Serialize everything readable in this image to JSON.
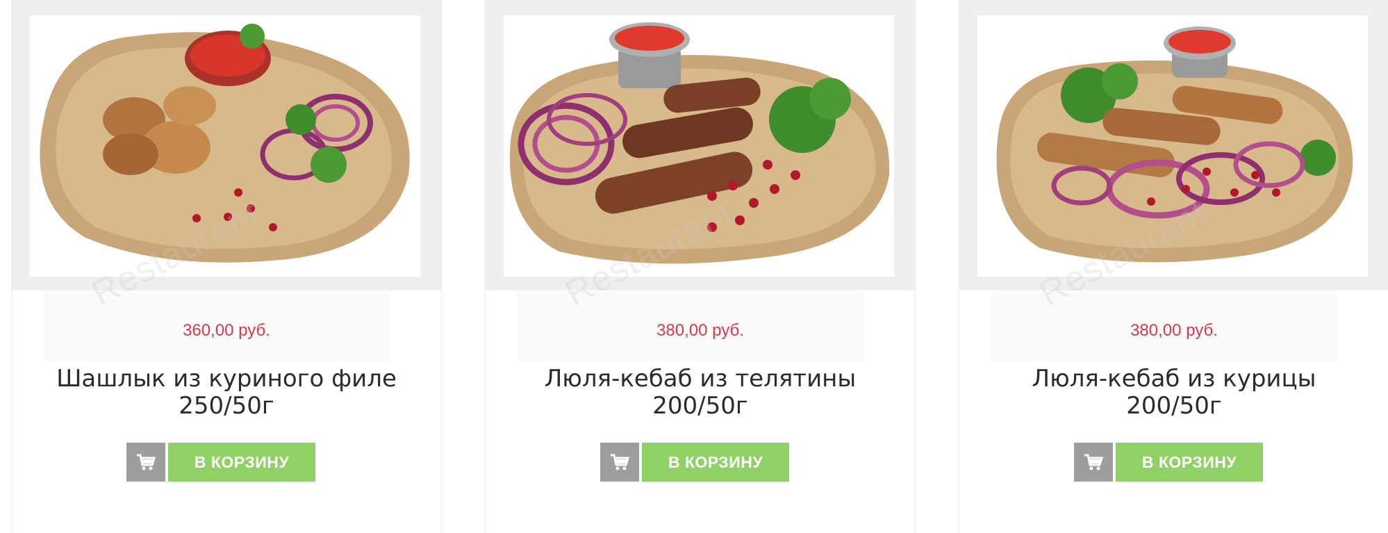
{
  "products": [
    {
      "price": "360,00 руб.",
      "title_line1": "Шашлык из куриного филе",
      "title_line2": "250/50г",
      "watermark": "Restaurant",
      "cart_label": "В КОРЗИНУ",
      "image_icon": "chicken-kebab-photo"
    },
    {
      "price": "380,00 руб.",
      "title_line1": "Люля-кебаб из телятины",
      "title_line2": "200/50г",
      "watermark": "Restaurant",
      "cart_label": "В КОРЗИНУ",
      "image_icon": "veal-lula-kebab-photo"
    },
    {
      "price": "380,00 руб.",
      "title_line1": "Люля-кебаб из курицы",
      "title_line2": "200/50г",
      "watermark": "Restaurant",
      "cart_label": "В КОРЗИНУ",
      "image_icon": "chicken-lula-kebab-photo"
    }
  ],
  "colors": {
    "price": "#d9394e",
    "cart_button": "#8fd167",
    "cart_icon_bg": "#9e9e9e",
    "image_frame": "#efefef"
  },
  "icons": {
    "cart": "shopping-cart-icon"
  }
}
